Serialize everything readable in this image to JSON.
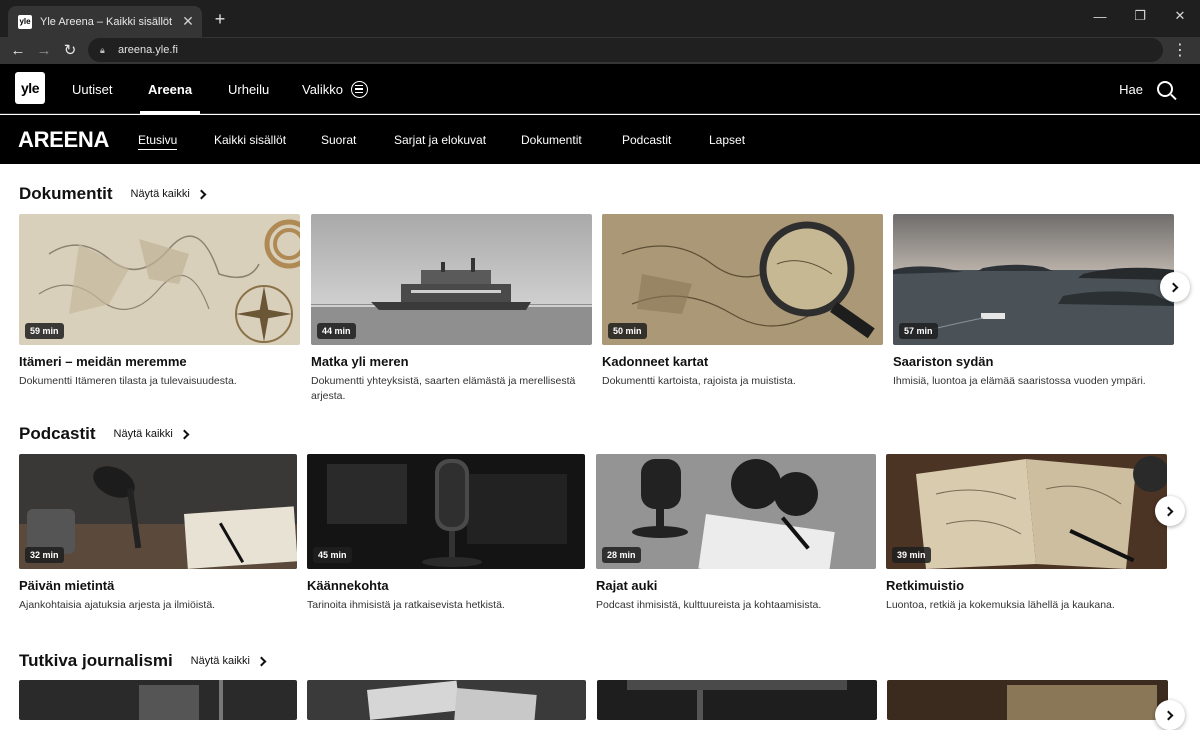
{
  "browser": {
    "tab_title": "Yle Areena – Kaikki sisällöt",
    "favicon_text": "yle",
    "url": "areena.yle.fi"
  },
  "topnav": {
    "logo": "yle",
    "items": [
      "Uutiset",
      "Areena",
      "Urheilu"
    ],
    "menu_label": "Valikko",
    "search_label": "Hae"
  },
  "areena": {
    "brand": "AREENA",
    "tabs": [
      "Etusivu",
      "Kaikki sisällöt",
      "Suorat",
      "Sarjat ja elokuvat",
      "Dokumentit",
      "Podcastit",
      "Lapset"
    ]
  },
  "sections": [
    {
      "title": "Dokumentit",
      "show_all": "Näytä kaikki",
      "cards": [
        {
          "duration": "59 min",
          "title": "Itämeri – meidän meremme",
          "desc": "Dokumentti Itämeren tilasta ja tulevaisuudesta."
        },
        {
          "duration": "44 min",
          "title": "Matka yli meren",
          "desc": "Dokumentti yhteyksistä, saarten elämästä ja merellisestä arjesta."
        },
        {
          "duration": "50 min",
          "title": "Kadonneet kartat",
          "desc": "Dokumentti kartoista, rajoista ja muistista."
        },
        {
          "duration": "57 min",
          "title": "Saariston sydän",
          "desc": "Ihmisiä, luontoa ja elämää saaristossa vuoden ympäri."
        }
      ]
    },
    {
      "title": "Podcastit",
      "show_all": "Näytä kaikki",
      "cards": [
        {
          "duration": "32 min",
          "title": "Päivän mietintä",
          "desc": "Ajankohtaisia ajatuksia arjesta ja ilmiöistä."
        },
        {
          "duration": "45 min",
          "title": "Käännekohta",
          "desc": "Tarinoita ihmisistä ja ratkaisevista hetkistä."
        },
        {
          "duration": "28 min",
          "title": "Rajat auki",
          "desc": "Podcast ihmisistä, kulttuureista ja kohtaamisista."
        },
        {
          "duration": "39 min",
          "title": "Retkimuistio",
          "desc": "Luontoa, retkiä ja kokemuksia lähellä ja kaukana."
        }
      ]
    },
    {
      "title": "Tutkiva journalismi",
      "show_all": "Näytä kaikki"
    }
  ]
}
